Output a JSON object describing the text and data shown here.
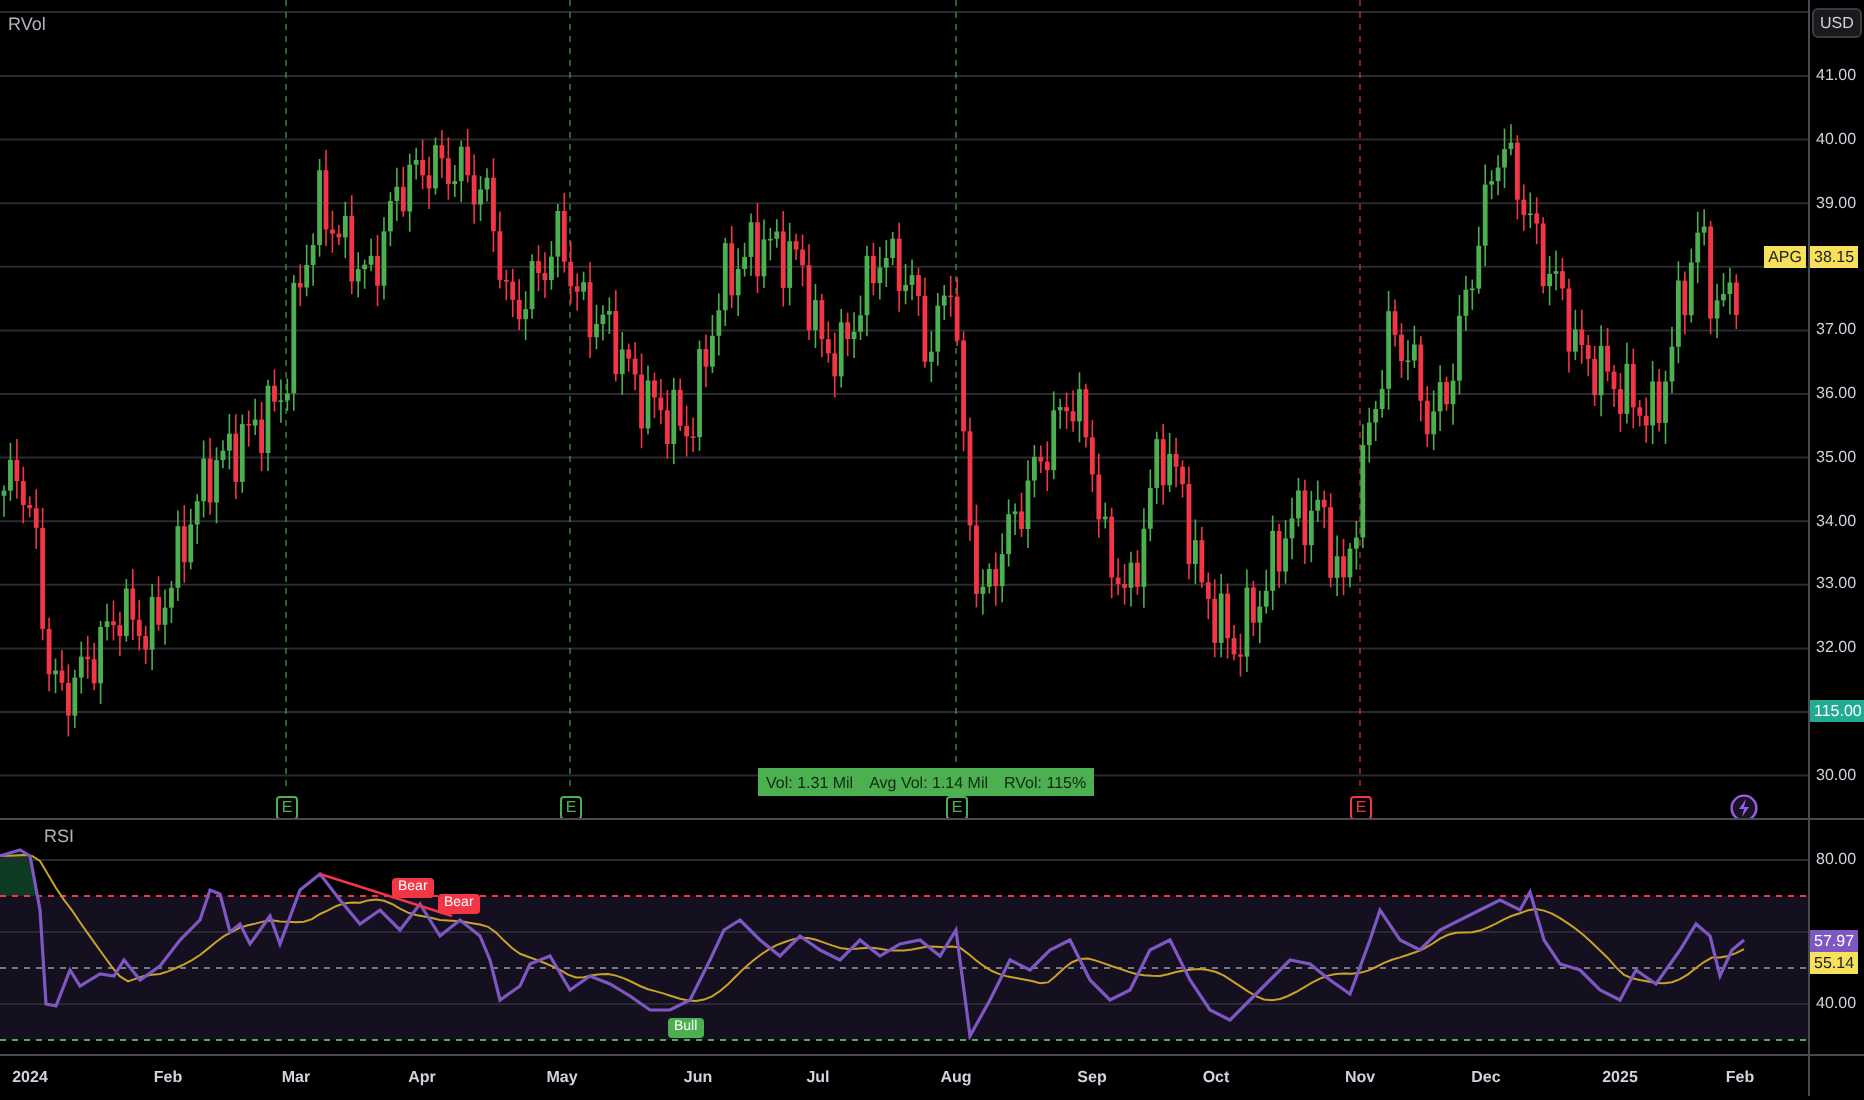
{
  "indicator_label": "RVol",
  "currency": "USD",
  "price_axis": [
    "41.00",
    "40.00",
    "39.00",
    "37.00",
    "36.00",
    "35.00",
    "34.00",
    "33.00",
    "32.00",
    "30.00"
  ],
  "last_price": {
    "symbol": "APG",
    "value": "38.15"
  },
  "volume_badge": "115.00",
  "events": [
    {
      "kind": "earnings",
      "label": "E",
      "color": "#4caf50"
    },
    {
      "kind": "earnings",
      "label": "E",
      "color": "#4caf50"
    },
    {
      "kind": "earnings",
      "label": "E",
      "color": "#4caf50"
    },
    {
      "kind": "earnings",
      "label": "E",
      "color": "#f23645"
    },
    {
      "kind": "flash",
      "color": "#9c5fe0"
    }
  ],
  "volume_info": [
    "Vol: 1.31 Mil",
    "Avg Vol: 1.14 Mil",
    "RVol: 115%"
  ],
  "rsi": {
    "label": "RSI",
    "axis": [
      "80.00",
      "40.00"
    ],
    "value": "57.97",
    "average": "55.14",
    "signals": [
      {
        "kind": "bear",
        "label": "Bear"
      },
      {
        "kind": "bear",
        "label": "Bear"
      },
      {
        "kind": "bull",
        "label": "Bull"
      }
    ]
  },
  "time_axis": [
    "2024",
    "Feb",
    "Mar",
    "Apr",
    "May",
    "Jun",
    "Jul",
    "Aug",
    "Sep",
    "Oct",
    "Nov",
    "Dec",
    "2025",
    "Feb"
  ]
}
